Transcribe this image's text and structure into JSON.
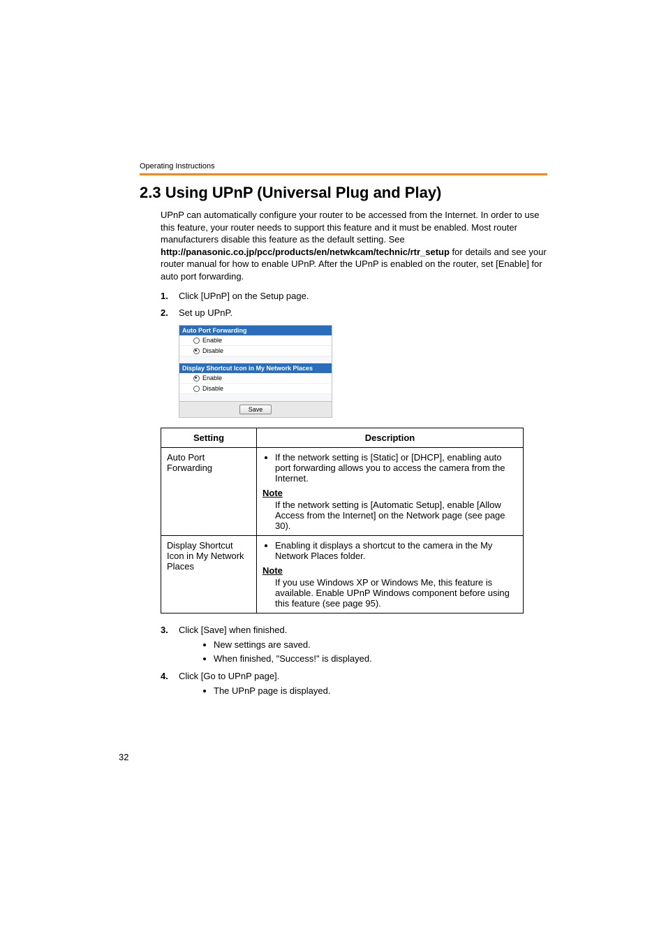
{
  "running_header": "Operating Instructions",
  "section_title": "2.3   Using UPnP (Universal Plug and Play)",
  "intro": {
    "pre": "UPnP can automatically configure your router to be accessed from the Internet. In order to use this feature, your router needs to support this feature and it must be enabled. Most router manufacturers disable this feature as the default setting. See ",
    "bold_url": "http://panasonic.co.jp/pcc/products/en/netwkcam/technic/rtr_setup",
    "post": " for details and see your router manual for how to enable UPnP. After the UPnP is enabled on the router, set [Enable] for auto port forwarding."
  },
  "steps_top": [
    {
      "n": "1.",
      "text": "Click [UPnP] on the Setup page."
    },
    {
      "n": "2.",
      "text": "Set up UPnP."
    }
  ],
  "ui": {
    "header1": "Auto Port Forwarding",
    "opt_enable": "Enable",
    "opt_disable": "Disable",
    "header2": "Display Shortcut Icon in My Network Places",
    "save": "Save"
  },
  "table": {
    "col_setting": "Setting",
    "col_description": "Description",
    "rows": [
      {
        "setting": "Auto Port Forwarding",
        "bullet": "If the network setting is [Static] or [DHCP], enabling auto port forwarding allows you to access the camera from the Internet.",
        "note_label": "Note",
        "note_body": "If the network setting is [Automatic Setup], enable [Allow Access from the Internet] on the Network page (see page 30)."
      },
      {
        "setting": "Display Shortcut Icon in My Network Places",
        "bullet": "Enabling it displays a shortcut to the camera in the My Network Places folder.",
        "note_label": "Note",
        "note_body": "If you use Windows XP or Windows Me, this feature is available. Enable UPnP Windows component before using this feature (see page 95)."
      }
    ]
  },
  "steps_bottom": [
    {
      "n": "3.",
      "text": "Click [Save] when finished.",
      "subs": [
        "New settings are saved.",
        "When finished, \"Success!\" is displayed."
      ]
    },
    {
      "n": "4.",
      "text": "Click [Go to UPnP page].",
      "subs": [
        "The UPnP page is displayed."
      ]
    }
  ],
  "page_number": "32"
}
